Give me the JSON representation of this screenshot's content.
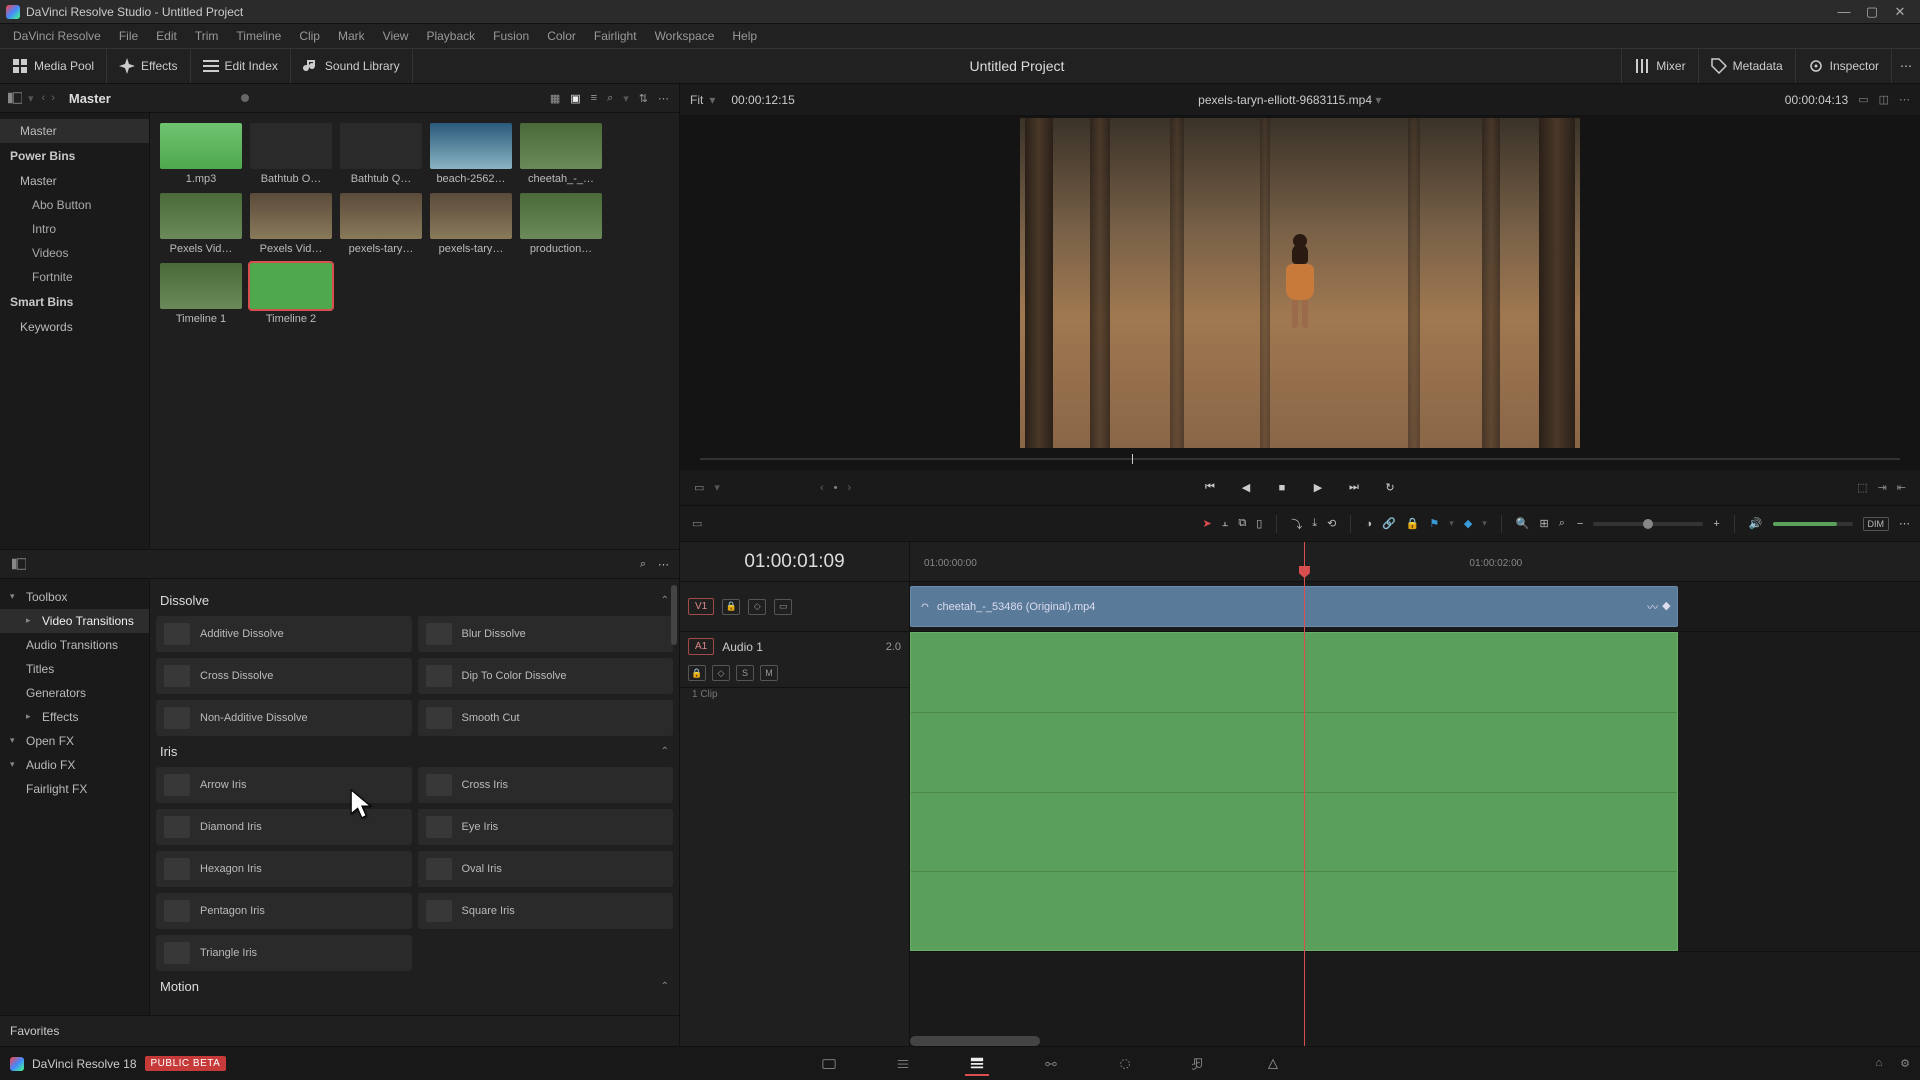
{
  "window": {
    "title": "DaVinci Resolve Studio - Untitled Project"
  },
  "menubar": [
    "DaVinci Resolve",
    "File",
    "Edit",
    "Trim",
    "Timeline",
    "Clip",
    "Mark",
    "View",
    "Playback",
    "Fusion",
    "Color",
    "Fairlight",
    "Workspace",
    "Help"
  ],
  "toolbar": {
    "media_pool": "Media Pool",
    "effects": "Effects",
    "edit_index": "Edit Index",
    "sound_library": "Sound Library",
    "project": "Untitled Project",
    "mixer": "Mixer",
    "metadata": "Metadata",
    "inspector": "Inspector"
  },
  "mediapool": {
    "path": "Master",
    "bins": {
      "master": "Master",
      "power": "Power Bins",
      "power_items": [
        "Master",
        "Abo Button",
        "Intro",
        "Videos",
        "Fortnite"
      ],
      "smart": "Smart Bins",
      "smart_items": [
        "Keywords"
      ]
    },
    "clips": [
      {
        "label": "1.mp3",
        "cls": "audio"
      },
      {
        "label": "Bathtub O…",
        "cls": "dark"
      },
      {
        "label": "Bathtub Q…",
        "cls": "dark"
      },
      {
        "label": "beach-2562…",
        "cls": "ocean"
      },
      {
        "label": "cheetah_-_…",
        "cls": "grass"
      },
      {
        "label": "Pexels Vid…",
        "cls": "grass"
      },
      {
        "label": "Pexels Vid…",
        "cls": "forest"
      },
      {
        "label": "pexels-tary…",
        "cls": "forest"
      },
      {
        "label": "pexels-tary…",
        "cls": "forest"
      },
      {
        "label": "production…",
        "cls": "grass"
      },
      {
        "label": "Timeline 1",
        "cls": "grass"
      },
      {
        "label": "Timeline 2",
        "cls": "green",
        "sel": true
      }
    ]
  },
  "fx": {
    "tree": [
      {
        "label": "Toolbox",
        "caret": "▾"
      },
      {
        "label": "Video Transitions",
        "caret": "▸",
        "sel": true,
        "sub": true
      },
      {
        "label": "Audio Transitions",
        "sub": true
      },
      {
        "label": "Titles",
        "sub": true
      },
      {
        "label": "Generators",
        "sub": true
      },
      {
        "label": "Effects",
        "caret": "▸",
        "sub": true
      },
      {
        "label": "Open FX",
        "caret": "▾"
      },
      {
        "label": "Audio FX",
        "caret": "▾"
      },
      {
        "label": "Fairlight FX",
        "sub": true
      }
    ],
    "favorites": "Favorites",
    "cats": [
      {
        "name": "Dissolve",
        "items": [
          "Additive Dissolve",
          "Blur Dissolve",
          "Cross Dissolve",
          "Dip To Color Dissolve",
          "Non-Additive Dissolve",
          "Smooth Cut"
        ]
      },
      {
        "name": "Iris",
        "items": [
          "Arrow Iris",
          "Cross Iris",
          "Diamond Iris",
          "Eye Iris",
          "Hexagon Iris",
          "Oval Iris",
          "Pentagon Iris",
          "Square Iris",
          "Triangle Iris"
        ]
      },
      {
        "name": "Motion",
        "items": []
      }
    ]
  },
  "viewer": {
    "fit": "Fit",
    "source_tc": "00:00:12:15",
    "clipname": "pexels-taryn-elliott-9683115.mp4",
    "dur_tc": "00:00:04:13"
  },
  "timeline": {
    "tc": "01:00:01:09",
    "ruler": [
      "01:00:00:00",
      "01:00:02:00"
    ],
    "playhead_pct": 39,
    "video": {
      "badge": "V1",
      "clip": "cheetah_-_53486 (Original).mp4"
    },
    "audio": {
      "badge": "A1",
      "name": "Audio 1",
      "gain": "2.0",
      "sub": "1 Clip"
    }
  },
  "pagebar": {
    "app": "DaVinci Resolve 18",
    "beta": "PUBLIC BETA"
  }
}
